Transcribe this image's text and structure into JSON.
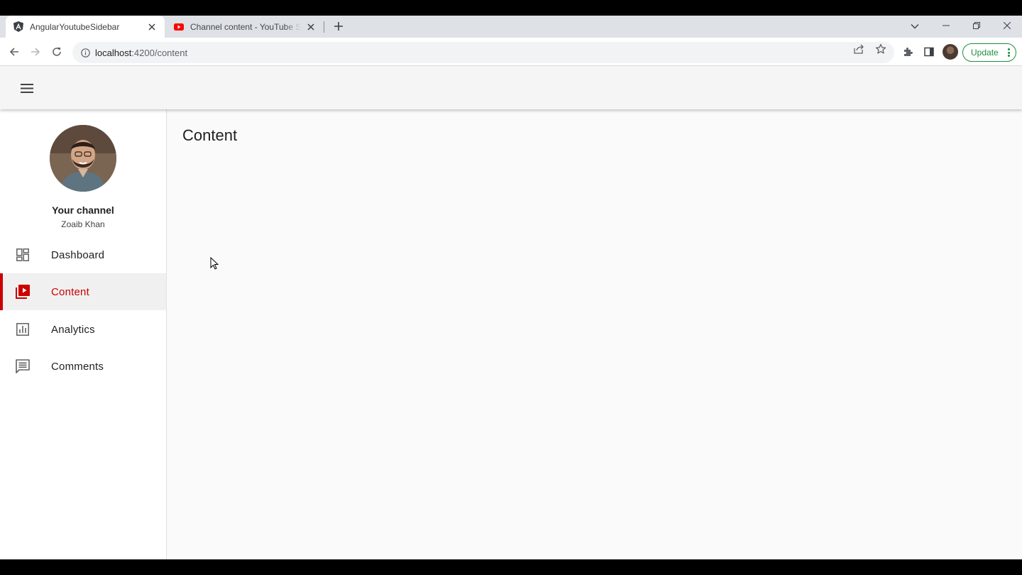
{
  "browser": {
    "tabs": [
      {
        "title": "AngularYoutubeSidebar",
        "active": true,
        "favicon": "angular-icon"
      },
      {
        "title": "Channel content - YouTube Studio",
        "active": false,
        "favicon": "youtube-icon"
      }
    ],
    "address": {
      "host": "localhost",
      "path": ":4200/content"
    },
    "update_label": "Update"
  },
  "sidebar": {
    "channel_title": "Your channel",
    "channel_name": "Zoaib Khan",
    "items": [
      {
        "label": "Dashboard",
        "icon": "dashboard-icon",
        "active": false
      },
      {
        "label": "Content",
        "icon": "video-library-icon",
        "active": true
      },
      {
        "label": "Analytics",
        "icon": "analytics-icon",
        "active": false
      },
      {
        "label": "Comments",
        "icon": "comments-icon",
        "active": false
      }
    ]
  },
  "main": {
    "title": "Content"
  },
  "colors": {
    "accent": "#cc0000",
    "update_green": "#1e8e3e"
  }
}
